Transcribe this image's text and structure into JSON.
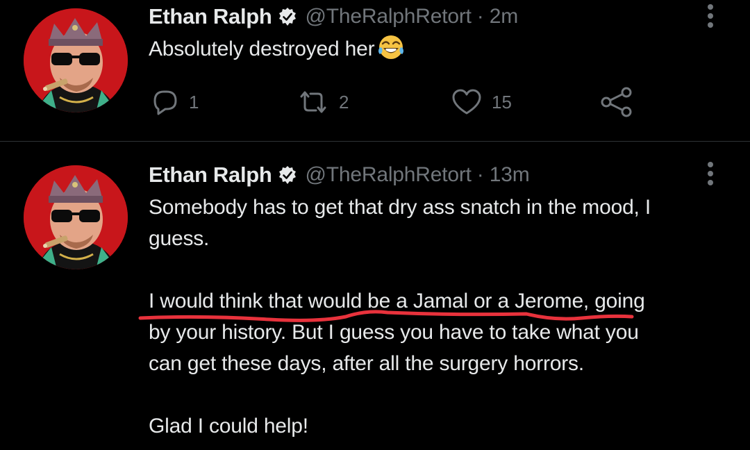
{
  "tweets": [
    {
      "author_name": "Ethan Ralph",
      "handle": "@TheRalphRetort",
      "separator": "·",
      "time": "2m",
      "text_lines": [
        "Absolutely destroyed her"
      ],
      "emoji": "face-with-tears-of-joy",
      "reply_count": "1",
      "retweet_count": "2",
      "like_count": "15"
    },
    {
      "author_name": "Ethan Ralph",
      "handle": "@TheRalphRetort",
      "separator": "·",
      "time": "13m",
      "paragraphs": [
        [
          "Somebody has to get that dry ass snatch in the mood, I",
          "guess."
        ],
        [
          "I would think that would be a Jamal or a Jerome, going",
          "by your history. But I guess you have to take what you",
          "can get these days, after all the surgery horrors."
        ],
        [
          "Glad I could help!"
        ]
      ]
    }
  ],
  "colors": {
    "background": "#000000",
    "text_primary": "#e7e9ea",
    "text_secondary": "#71767b",
    "divider": "#2f3336",
    "annotation_red": "#e8323c",
    "avatar_red": "#c8161b"
  },
  "icons": [
    "more-icon",
    "verified-badge-icon",
    "reply-icon",
    "retweet-icon",
    "like-icon",
    "share-icon"
  ]
}
